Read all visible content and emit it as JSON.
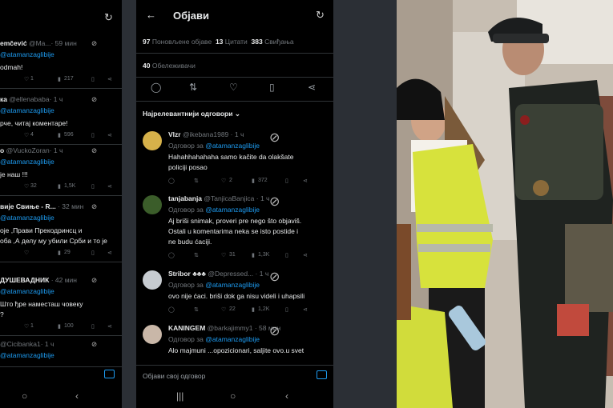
{
  "left_panel": {
    "rows": [
      {
        "author": "emčević",
        "handle": "@Ma...",
        "time": "· 59 мин",
        "reply_to": "@atamanzaglibije",
        "text": "odmah!",
        "likes": "1",
        "views": "217"
      },
      {
        "author": "ка",
        "handle": "@ellenababa",
        "time": "· 1 ч",
        "reply_to": "@atamanzaglibije",
        "text": "рче, читај коментаре!",
        "likes": "4",
        "views": "596"
      },
      {
        "author": "о",
        "handle": "@VuckoZoran",
        "time": "· 1 ч",
        "reply_to": "@atamanzaglibije",
        "text": "је наш !!!",
        "likes": "32",
        "views": "1,5K"
      },
      {
        "author": "вије Свиње - R...",
        "handle": "",
        "time": "· 32 мин",
        "reply_to": "@atamanzaglibije",
        "text_lines": [
          "оје ,Прави Прекодринсц и",
          "оба ,А делу му убили Срби и то је"
        ],
        "likes": "",
        "views": "29"
      },
      {
        "author": "ДУШЕВАДНИК",
        "handle": "",
        "time": "· 42 мин",
        "reply_to": "@atamanzaglibije",
        "text_lines": [
          "Што ђре наместаш човеку",
          "?"
        ],
        "likes": "1",
        "views": "100"
      },
      {
        "author": "",
        "handle": "@Cicibanka1",
        "time": "· 1 ч",
        "reply_to": "@atamanzaglibije",
        "text": "",
        "likes": "",
        "views": ""
      }
    ]
  },
  "mid_panel": {
    "title": "Објави",
    "stats": {
      "reposts_num": "97",
      "reposts_label": "Поновљене објаве",
      "quotes_num": "13",
      "quotes_label": "Цитати",
      "likes_num": "383",
      "likes_label": "Свиђања",
      "bookmarks_num": "40",
      "bookmarks_label": "Обележивачи"
    },
    "sort_label": "Најрелевантнији одговори",
    "reply_prefix": "Одговор за",
    "reply_to": "@atamanzaglibije",
    "tweets": [
      {
        "name": "Vlzr",
        "handle": "@ikebana1989",
        "time": "· 1 ч",
        "lines": [
          "Hahahhahahaha samo kačite da olakšate",
          "policiji posao"
        ],
        "replies": "",
        "likes": "2",
        "views": "372"
      },
      {
        "name": "tanjabanja",
        "handle": "@TanjicaBanjica",
        "time": "· 1 ч",
        "lines": [
          "Aj briši snimak, proveri pre nego što objaviš.",
          "Ostali u komentarima neka se isto postide i",
          "ne budu ćaciji."
        ],
        "replies": "",
        "likes": "31",
        "views": "1,3K"
      },
      {
        "name": "Stribor ♣♣♣",
        "handle": "@Depressed...",
        "time": "· 1 ч",
        "lines": [
          "ovo nije ćaci. briši dok ga nisu videli i uhapsili"
        ],
        "replies": "",
        "likes": "22",
        "views": "1,2K"
      },
      {
        "name": "KANINGEM",
        "handle": "@barkajimmy1",
        "time": "· 58 мин",
        "lines": [
          "Alo majmuni ...opozicionari, saljite ovo.u svet"
        ],
        "replies": "",
        "likes": "",
        "views": ""
      }
    ],
    "composer_placeholder": "Објави свој одговор"
  }
}
